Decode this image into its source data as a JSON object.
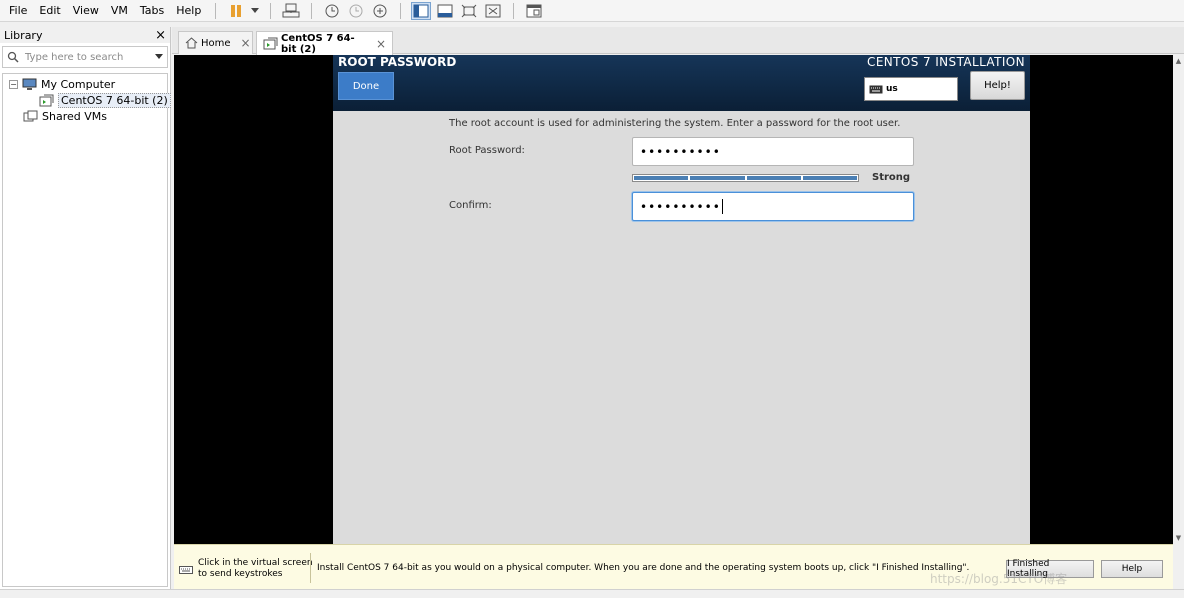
{
  "menubar": {
    "items": [
      "File",
      "Edit",
      "View",
      "VM",
      "Tabs",
      "Help"
    ]
  },
  "toolbar": {
    "icons": [
      "pause-icon",
      "dropdown-arrow-icon",
      "send-ctrl-alt-del-icon",
      "snapshot-take-icon",
      "snapshot-revert-icon",
      "snapshot-manager-icon",
      "show-library-icon",
      "thumbnail-bar-icon",
      "full-screen-icon",
      "unity-icon",
      "console-view-icon"
    ],
    "accent": "#e8a030"
  },
  "library": {
    "title": "Library",
    "close": "×",
    "search_placeholder": "Type here to search",
    "tree": {
      "expander": "−",
      "my_computer": "My Computer",
      "vm": "CentOS 7 64-bit (2)",
      "shared": "Shared VMs"
    }
  },
  "tabs": [
    {
      "label": "Home",
      "close": "×"
    },
    {
      "label": "CentOS 7 64-bit (2)",
      "close": "×"
    }
  ],
  "installer": {
    "title": "ROOT PASSWORD",
    "product": "CENTOS 7 INSTALLATION",
    "done_label": "Done",
    "keyboard_layout": "us",
    "help_label": "Help!",
    "description": "The root account is used for administering the system.  Enter a password for the root user.",
    "root_password_label": "Root Password:",
    "root_password_value": "••••••••••",
    "strength_label": "Strong",
    "strength_level": 1.0,
    "confirm_label": "Confirm:",
    "confirm_value": "••••••••••",
    "header_color": "#163558",
    "done_color": "#3c7cc8"
  },
  "bottombar": {
    "kb_hint_line1": "Click in the virtual screen",
    "kb_hint_line2": "to send keystrokes",
    "message": "Install CentOS 7 64-bit as you would on a physical computer. When you are done and the operating system boots up, click \"I Finished Installing\".",
    "finished_label": "I Finished Installing",
    "help_label": "Help"
  },
  "watermark": "https://blog.51CTO博客"
}
